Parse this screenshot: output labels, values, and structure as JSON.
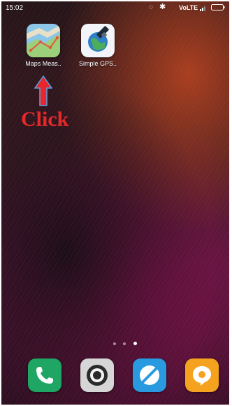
{
  "status_bar": {
    "time": "15:02",
    "network": "VoLTE",
    "icons": [
      "alarm-icon",
      "bluetooth-icon",
      "signal-icon",
      "battery-icon"
    ]
  },
  "apps": [
    {
      "label": "Maps Meas..",
      "icon": "map-measure-icon",
      "color": "#6fb9e0"
    },
    {
      "label": "Simple GPS..",
      "icon": "satellite-icon",
      "color": "#f2f4f7"
    }
  ],
  "annotation": {
    "text": "Click",
    "color": "#e6282a",
    "arrow_color": "#e6282a",
    "arrow_outline": "#5aa0e6"
  },
  "page_indicator": {
    "pages": 3,
    "current": 3
  },
  "dock": [
    {
      "icon": "phone-icon",
      "color": "#1fa564"
    },
    {
      "icon": "camera-icon",
      "color": "#d6d6d6"
    },
    {
      "icon": "browser-icon",
      "color": "#2a9ae0"
    },
    {
      "icon": "messages-icon",
      "color": "#f5a21e"
    }
  ]
}
